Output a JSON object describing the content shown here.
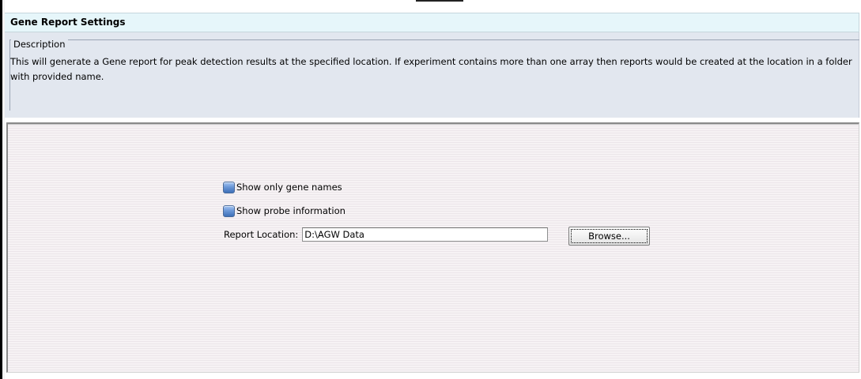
{
  "dialog": {
    "title": "Gene Report Settings"
  },
  "description": {
    "legend": "Description",
    "text": "This will generate a Gene report for peak detection results at the specified location. If experiment contains more than one array then reports would be created at the location in a folder with provided name."
  },
  "options": {
    "show_gene_names": {
      "label": "Show only gene names",
      "checked": false
    },
    "show_probe_info": {
      "label": "Show probe information",
      "checked": false
    }
  },
  "report_location": {
    "label": "Report Location:",
    "value": "D:\\AGW Data"
  },
  "buttons": {
    "browse_label": "Browse..."
  },
  "colors": {
    "title_bar_bg": "#e6f6fa",
    "description_bg": "#e2e7ef",
    "checkbox_fill": "#6b98d8",
    "content_stripe_light": "#f6f2f4",
    "content_stripe_dark": "#ece6ea"
  }
}
